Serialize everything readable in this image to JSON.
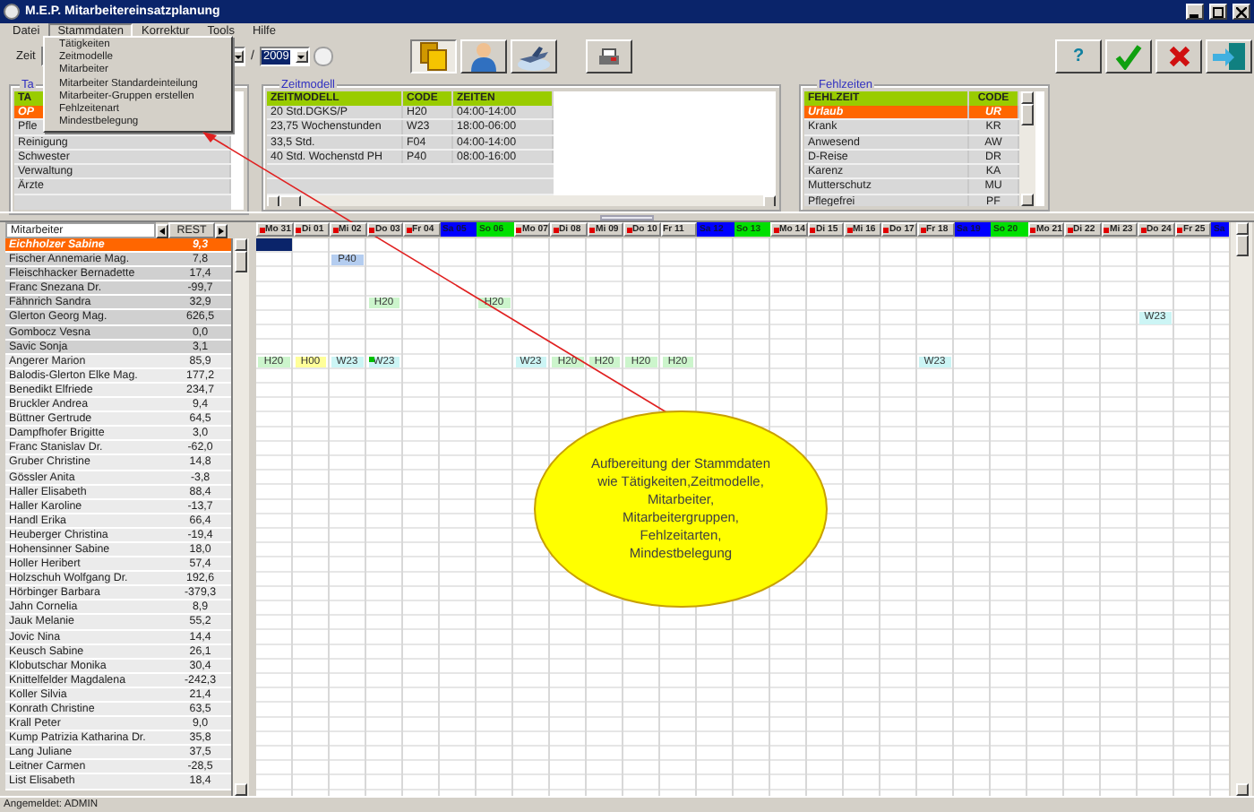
{
  "window": {
    "title": "M.E.P. Mitarbeitereinsatzplanung"
  },
  "menu": [
    {
      "label": "Datei",
      "open": false
    },
    {
      "label": "Stammdaten",
      "open": true
    },
    {
      "label": "Korrektur",
      "open": false
    },
    {
      "label": "Tools",
      "open": false
    },
    {
      "label": "Hilfe",
      "open": false
    }
  ],
  "dropdown": [
    "Tätigkeiten",
    "Zeitmodelle",
    "Mitarbeiter",
    "Mitarbeiter Standardeinteilung",
    "Mitarbeiter-Gruppen erstellen",
    "Fehlzeitenart",
    "Mindestbelegung"
  ],
  "toolbar": {
    "label": "Zeit",
    "separator": "/",
    "year": "2009",
    "help": "?"
  },
  "activities": {
    "title": "Ta",
    "column": "TA",
    "rows": [
      {
        "label": "OP",
        "selected": true
      },
      {
        "label": "Pfle",
        "selected": false
      },
      {
        "label": "Reinigung",
        "selected": false
      },
      {
        "label": "Schwester",
        "selected": false
      },
      {
        "label": "Verwaltung",
        "selected": false
      },
      {
        "label": "Ärzte",
        "selected": false
      }
    ]
  },
  "time_models": {
    "title": "Zeitmodell",
    "columns": [
      "ZEITMODELL",
      "CODE",
      "ZEITEN"
    ],
    "rows": [
      [
        "20 Std.DGKS/P",
        "H20",
        "04:00-14:00"
      ],
      [
        "23,75 Wochenstunden",
        "W23",
        "18:00-06:00"
      ],
      [
        "33,5 Std.",
        "F04",
        "04:00-14:00"
      ],
      [
        "40 Std. Wochenstd PH",
        "P40",
        "08:00-16:00"
      ]
    ]
  },
  "absences": {
    "title": "Fehlzeiten",
    "columns": [
      "FEHLZEIT",
      "CODE"
    ],
    "rows": [
      {
        "name": "Urlaub",
        "code": "UR",
        "selected": true
      },
      {
        "name": "Krank",
        "code": "KR",
        "selected": false
      },
      {
        "name": "Anwesend",
        "code": "AW",
        "selected": false
      },
      {
        "name": "D-Reise",
        "code": "DR",
        "selected": false
      },
      {
        "name": "Karenz",
        "code": "KA",
        "selected": false
      },
      {
        "name": "Mutterschutz",
        "code": "MU",
        "selected": false
      },
      {
        "name": "Pflegefrei",
        "code": "PF",
        "selected": false
      }
    ]
  },
  "days": [
    {
      "label": "Mo 31",
      "kind": "weekday",
      "flag": true
    },
    {
      "label": "Di 01",
      "kind": "weekday",
      "flag": true
    },
    {
      "label": "Mi 02",
      "kind": "weekday",
      "flag": true
    },
    {
      "label": "Do 03",
      "kind": "weekday",
      "flag": true
    },
    {
      "label": "Fr 04",
      "kind": "weekday",
      "flag": true
    },
    {
      "label": "Sa 05",
      "kind": "saturday",
      "flag": false
    },
    {
      "label": "So 06",
      "kind": "sunday",
      "flag": false
    },
    {
      "label": "Mo 07",
      "kind": "weekday",
      "flag": true
    },
    {
      "label": "Di 08",
      "kind": "weekday",
      "flag": true
    },
    {
      "label": "Mi 09",
      "kind": "weekday",
      "flag": true
    },
    {
      "label": "Do 10",
      "kind": "weekday",
      "flag": true
    },
    {
      "label": "Fr 11",
      "kind": "weekday",
      "flag": false
    },
    {
      "label": "Sa 12",
      "kind": "saturday",
      "flag": false
    },
    {
      "label": "So 13",
      "kind": "sunday",
      "flag": false
    },
    {
      "label": "Mo 14",
      "kind": "weekday",
      "flag": true
    },
    {
      "label": "Di 15",
      "kind": "weekday",
      "flag": true
    },
    {
      "label": "Mi 16",
      "kind": "weekday",
      "flag": true
    },
    {
      "label": "Do 17",
      "kind": "weekday",
      "flag": true
    },
    {
      "label": "Fr 18",
      "kind": "weekday",
      "flag": true
    },
    {
      "label": "Sa 19",
      "kind": "saturday",
      "flag": false
    },
    {
      "label": "So 20",
      "kind": "sunday",
      "flag": false
    },
    {
      "label": "Mo 21",
      "kind": "weekday",
      "flag": true
    },
    {
      "label": "Di 22",
      "kind": "weekday",
      "flag": true
    },
    {
      "label": "Mi 23",
      "kind": "weekday",
      "flag": true
    },
    {
      "label": "Do 24",
      "kind": "weekday",
      "flag": true
    },
    {
      "label": "Fr 25",
      "kind": "weekday",
      "flag": true
    },
    {
      "label": "Sa",
      "kind": "saturday",
      "flag": false
    }
  ],
  "staff": {
    "columns": [
      "Mitarbeiter",
      "REST"
    ],
    "rows": [
      {
        "name": "Eichholzer Sabine",
        "rest": "9,3",
        "selected": true,
        "shaded": true,
        "cells": [
          {
            "selected": true
          }
        ]
      },
      {
        "name": "Fischer Annemarie Mag.",
        "rest": "7,8",
        "selected": false,
        "shaded": true,
        "cells": [
          null,
          null,
          {
            "code": "P40",
            "color": "#b4cdf0"
          }
        ]
      },
      {
        "name": "Fleischhacker Bernadette",
        "rest": "17,4",
        "selected": false,
        "shaded": true
      },
      {
        "name": "Franc Snezana Dr.",
        "rest": "-99,7",
        "selected": false,
        "shaded": true
      },
      {
        "name": "Fähnrich Sandra",
        "rest": "32,9",
        "selected": false,
        "shaded": true,
        "cells": [
          null,
          null,
          null,
          {
            "code": "H20",
            "color": "#ccf5cc"
          },
          null,
          null,
          {
            "code": "H20",
            "color": "#ccf5cc"
          }
        ]
      },
      {
        "name": "Glerton Georg Mag.",
        "rest": "626,5",
        "selected": false,
        "shaded": true,
        "cells": [
          null,
          null,
          null,
          null,
          null,
          null,
          null,
          null,
          null,
          null,
          null,
          null,
          null,
          null,
          null,
          null,
          null,
          null,
          null,
          null,
          null,
          null,
          null,
          null,
          {
            "code": "W23",
            "color": "#ccf5f5"
          }
        ]
      },
      {
        "name": "Gombocz Vesna",
        "rest": "0,0",
        "selected": false,
        "shaded": true
      },
      {
        "name": "Savic Sonja",
        "rest": "3,1",
        "selected": false,
        "shaded": true
      },
      {
        "name": "Angerer Marion",
        "rest": "85,9",
        "selected": false,
        "shaded": false,
        "cells": [
          {
            "code": "H20",
            "color": "#ccf5cc"
          },
          {
            "code": "H00",
            "color": "#ffff99"
          },
          {
            "code": "W23",
            "color": "#ccf5f5"
          },
          {
            "code": "W23",
            "color": "#ccf5f5",
            "marker": true
          },
          null,
          null,
          null,
          {
            "code": "W23",
            "color": "#ccf5f5"
          },
          {
            "code": "H20",
            "color": "#ccf5cc"
          },
          {
            "code": "H20",
            "color": "#ccf5cc"
          },
          {
            "code": "H20",
            "color": "#ccf5cc"
          },
          {
            "code": "H20",
            "color": "#ccf5cc"
          },
          null,
          null,
          null,
          null,
          null,
          null,
          {
            "code": "W23",
            "color": "#ccf5f5"
          }
        ]
      },
      {
        "name": "Balodis-Glerton Elke Mag.",
        "rest": "177,2",
        "selected": false,
        "shaded": false
      },
      {
        "name": "Benedikt Elfriede",
        "rest": "234,7",
        "selected": false,
        "shaded": false
      },
      {
        "name": "Bruckler Andrea",
        "rest": "9,4",
        "selected": false,
        "shaded": false
      },
      {
        "name": "Büttner Gertrude",
        "rest": "64,5",
        "selected": false,
        "shaded": false
      },
      {
        "name": "Dampfhofer Brigitte",
        "rest": "3,0",
        "selected": false,
        "shaded": false
      },
      {
        "name": "Franc Stanislav Dr.",
        "rest": "-62,0",
        "selected": false,
        "shaded": false
      },
      {
        "name": "Gruber Christine",
        "rest": "14,8",
        "selected": false,
        "shaded": false
      },
      {
        "name": "Gössler Anita",
        "rest": "-3,8",
        "selected": false,
        "shaded": false
      },
      {
        "name": "Haller Elisabeth",
        "rest": "88,4",
        "selected": false,
        "shaded": false
      },
      {
        "name": "Haller Karoline",
        "rest": "-13,7",
        "selected": false,
        "shaded": false
      },
      {
        "name": "Handl Erika",
        "rest": "66,4",
        "selected": false,
        "shaded": false
      },
      {
        "name": "Heuberger Christina",
        "rest": "-19,4",
        "selected": false,
        "shaded": false
      },
      {
        "name": "Hohensinner Sabine",
        "rest": "18,0",
        "selected": false,
        "shaded": false
      },
      {
        "name": "Holler Heribert",
        "rest": "57,4",
        "selected": false,
        "shaded": false
      },
      {
        "name": "Holzschuh Wolfgang Dr.",
        "rest": "192,6",
        "selected": false,
        "shaded": false
      },
      {
        "name": "Hörbinger Barbara",
        "rest": "-379,3",
        "selected": false,
        "shaded": false
      },
      {
        "name": "Jahn Cornelia",
        "rest": "8,9",
        "selected": false,
        "shaded": false
      },
      {
        "name": "Jauk Melanie",
        "rest": "55,2",
        "selected": false,
        "shaded": false
      },
      {
        "name": "Jovic Nina",
        "rest": "14,4",
        "selected": false,
        "shaded": false
      },
      {
        "name": "Keusch Sabine",
        "rest": "26,1",
        "selected": false,
        "shaded": false
      },
      {
        "name": "Klobutschar Monika",
        "rest": "30,4",
        "selected": false,
        "shaded": false
      },
      {
        "name": "Knittelfelder Magdalena",
        "rest": "-242,3",
        "selected": false,
        "shaded": false
      },
      {
        "name": "Koller Silvia",
        "rest": "21,4",
        "selected": false,
        "shaded": false
      },
      {
        "name": "Konrath Christine",
        "rest": "63,5",
        "selected": false,
        "shaded": false
      },
      {
        "name": "Krall Peter",
        "rest": "9,0",
        "selected": false,
        "shaded": false
      },
      {
        "name": "Kump Patrizia Katharina Dr.",
        "rest": "35,8",
        "selected": false,
        "shaded": false
      },
      {
        "name": "Lang Juliane",
        "rest": "37,5",
        "selected": false,
        "shaded": false
      },
      {
        "name": "Leitner Carmen",
        "rest": "-28,5",
        "selected": false,
        "shaded": false
      },
      {
        "name": "List Elisabeth",
        "rest": "18,4",
        "selected": false,
        "shaded": false
      }
    ]
  },
  "callout": "Aufbereitung der Stammdaten wie Tätigkeiten,Zeitmodelle, Mitarbeiter, Mitarbeitergruppen, Fehlzeitarten, Mindestbelegung",
  "status_bar": "Angemeldet: ADMIN"
}
